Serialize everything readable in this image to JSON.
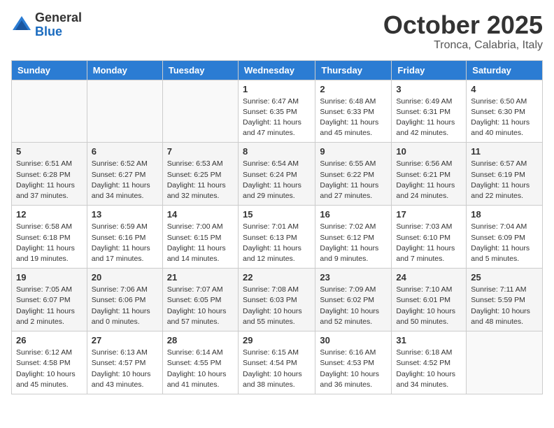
{
  "logo": {
    "general": "General",
    "blue": "Blue"
  },
  "header": {
    "month": "October 2025",
    "location": "Tronca, Calabria, Italy"
  },
  "weekdays": [
    "Sunday",
    "Monday",
    "Tuesday",
    "Wednesday",
    "Thursday",
    "Friday",
    "Saturday"
  ],
  "weeks": [
    [
      {
        "day": "",
        "info": ""
      },
      {
        "day": "",
        "info": ""
      },
      {
        "day": "",
        "info": ""
      },
      {
        "day": "1",
        "info": "Sunrise: 6:47 AM\nSunset: 6:35 PM\nDaylight: 11 hours\nand 47 minutes."
      },
      {
        "day": "2",
        "info": "Sunrise: 6:48 AM\nSunset: 6:33 PM\nDaylight: 11 hours\nand 45 minutes."
      },
      {
        "day": "3",
        "info": "Sunrise: 6:49 AM\nSunset: 6:31 PM\nDaylight: 11 hours\nand 42 minutes."
      },
      {
        "day": "4",
        "info": "Sunrise: 6:50 AM\nSunset: 6:30 PM\nDaylight: 11 hours\nand 40 minutes."
      }
    ],
    [
      {
        "day": "5",
        "info": "Sunrise: 6:51 AM\nSunset: 6:28 PM\nDaylight: 11 hours\nand 37 minutes."
      },
      {
        "day": "6",
        "info": "Sunrise: 6:52 AM\nSunset: 6:27 PM\nDaylight: 11 hours\nand 34 minutes."
      },
      {
        "day": "7",
        "info": "Sunrise: 6:53 AM\nSunset: 6:25 PM\nDaylight: 11 hours\nand 32 minutes."
      },
      {
        "day": "8",
        "info": "Sunrise: 6:54 AM\nSunset: 6:24 PM\nDaylight: 11 hours\nand 29 minutes."
      },
      {
        "day": "9",
        "info": "Sunrise: 6:55 AM\nSunset: 6:22 PM\nDaylight: 11 hours\nand 27 minutes."
      },
      {
        "day": "10",
        "info": "Sunrise: 6:56 AM\nSunset: 6:21 PM\nDaylight: 11 hours\nand 24 minutes."
      },
      {
        "day": "11",
        "info": "Sunrise: 6:57 AM\nSunset: 6:19 PM\nDaylight: 11 hours\nand 22 minutes."
      }
    ],
    [
      {
        "day": "12",
        "info": "Sunrise: 6:58 AM\nSunset: 6:18 PM\nDaylight: 11 hours\nand 19 minutes."
      },
      {
        "day": "13",
        "info": "Sunrise: 6:59 AM\nSunset: 6:16 PM\nDaylight: 11 hours\nand 17 minutes."
      },
      {
        "day": "14",
        "info": "Sunrise: 7:00 AM\nSunset: 6:15 PM\nDaylight: 11 hours\nand 14 minutes."
      },
      {
        "day": "15",
        "info": "Sunrise: 7:01 AM\nSunset: 6:13 PM\nDaylight: 11 hours\nand 12 minutes."
      },
      {
        "day": "16",
        "info": "Sunrise: 7:02 AM\nSunset: 6:12 PM\nDaylight: 11 hours\nand 9 minutes."
      },
      {
        "day": "17",
        "info": "Sunrise: 7:03 AM\nSunset: 6:10 PM\nDaylight: 11 hours\nand 7 minutes."
      },
      {
        "day": "18",
        "info": "Sunrise: 7:04 AM\nSunset: 6:09 PM\nDaylight: 11 hours\nand 5 minutes."
      }
    ],
    [
      {
        "day": "19",
        "info": "Sunrise: 7:05 AM\nSunset: 6:07 PM\nDaylight: 11 hours\nand 2 minutes."
      },
      {
        "day": "20",
        "info": "Sunrise: 7:06 AM\nSunset: 6:06 PM\nDaylight: 11 hours\nand 0 minutes."
      },
      {
        "day": "21",
        "info": "Sunrise: 7:07 AM\nSunset: 6:05 PM\nDaylight: 10 hours\nand 57 minutes."
      },
      {
        "day": "22",
        "info": "Sunrise: 7:08 AM\nSunset: 6:03 PM\nDaylight: 10 hours\nand 55 minutes."
      },
      {
        "day": "23",
        "info": "Sunrise: 7:09 AM\nSunset: 6:02 PM\nDaylight: 10 hours\nand 52 minutes."
      },
      {
        "day": "24",
        "info": "Sunrise: 7:10 AM\nSunset: 6:01 PM\nDaylight: 10 hours\nand 50 minutes."
      },
      {
        "day": "25",
        "info": "Sunrise: 7:11 AM\nSunset: 5:59 PM\nDaylight: 10 hours\nand 48 minutes."
      }
    ],
    [
      {
        "day": "26",
        "info": "Sunrise: 6:12 AM\nSunset: 4:58 PM\nDaylight: 10 hours\nand 45 minutes."
      },
      {
        "day": "27",
        "info": "Sunrise: 6:13 AM\nSunset: 4:57 PM\nDaylight: 10 hours\nand 43 minutes."
      },
      {
        "day": "28",
        "info": "Sunrise: 6:14 AM\nSunset: 4:55 PM\nDaylight: 10 hours\nand 41 minutes."
      },
      {
        "day": "29",
        "info": "Sunrise: 6:15 AM\nSunset: 4:54 PM\nDaylight: 10 hours\nand 38 minutes."
      },
      {
        "day": "30",
        "info": "Sunrise: 6:16 AM\nSunset: 4:53 PM\nDaylight: 10 hours\nand 36 minutes."
      },
      {
        "day": "31",
        "info": "Sunrise: 6:18 AM\nSunset: 4:52 PM\nDaylight: 10 hours\nand 34 minutes."
      },
      {
        "day": "",
        "info": ""
      }
    ]
  ]
}
